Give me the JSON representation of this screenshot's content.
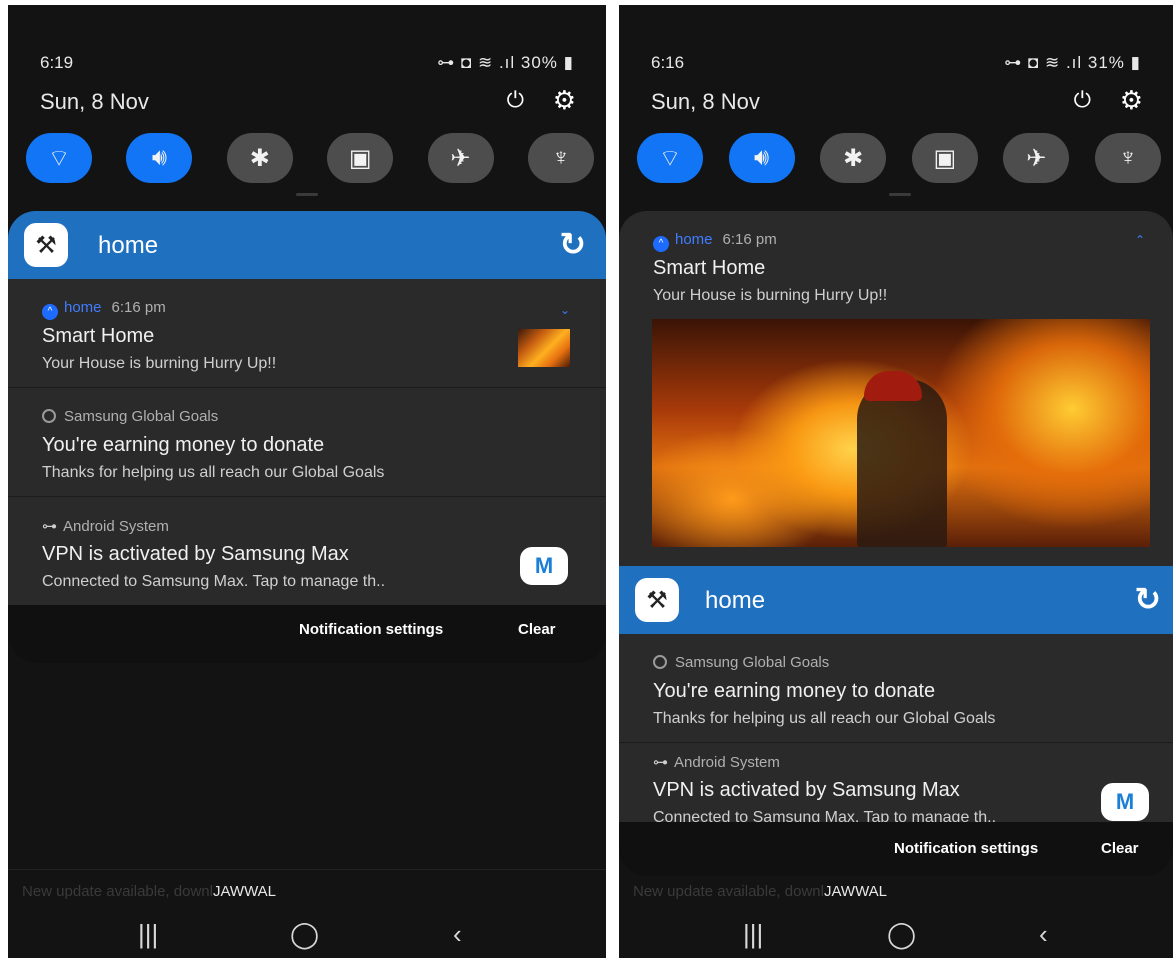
{
  "left": {
    "status": {
      "time": "6:19",
      "icons": "⊶ ◘ ≋ .ıl 30% ▮"
    },
    "date": "Sun, 8 Nov",
    "app_header": {
      "title": "home"
    },
    "notifications": [
      {
        "app": "home",
        "time": "6:16 pm",
        "title": "Smart Home",
        "body": "Your House is burning Hurry Up!!"
      },
      {
        "app": "Samsung Global Goals",
        "title": "You're earning money to donate",
        "body": "Thanks for helping us all reach our Global Goals"
      },
      {
        "app": "Android System",
        "title": "VPN is activated by Samsung Max",
        "body": "Connected to Samsung Max. Tap to manage th.."
      }
    ],
    "actions": {
      "settings": "Notification settings",
      "clear": "Clear"
    },
    "background": {
      "update_text": "New update available, downl",
      "carrier": "JAWWAL"
    }
  },
  "right": {
    "status": {
      "time": "6:16",
      "icons": "⊶ ◘ ≋ .ıl 31% ▮"
    },
    "date": "Sun, 8 Nov",
    "app_header": {
      "title": "home"
    },
    "notifications": [
      {
        "app": "home",
        "time": "6:16 pm",
        "title": "Smart Home",
        "body": "Your House is burning Hurry Up!!"
      },
      {
        "app": "Samsung Global Goals",
        "title": "You're earning money to donate",
        "body": "Thanks for helping us all reach our Global Goals"
      },
      {
        "app": "Android System",
        "title": "VPN is activated by Samsung Max",
        "body": "Connected to Samsung Max. Tap to manage th.."
      }
    ],
    "actions": {
      "settings": "Notification settings",
      "clear": "Clear"
    },
    "background": {
      "update_text": "New update available, downl",
      "carrier": "JAWWAL"
    }
  },
  "icons": {
    "wifi": "wifi-icon",
    "sound": "sound-icon",
    "bluetooth": "bluetooth-icon",
    "lock": "screen-lock-icon",
    "airplane": "airplane-icon",
    "flashlight": "flashlight-icon",
    "power": "power-icon",
    "settings": "gear-icon",
    "refresh": "refresh-icon"
  },
  "colors": {
    "accent": "#1275f5",
    "header": "#2070c0",
    "panel": "#2a2a2a",
    "background": "#131313"
  }
}
